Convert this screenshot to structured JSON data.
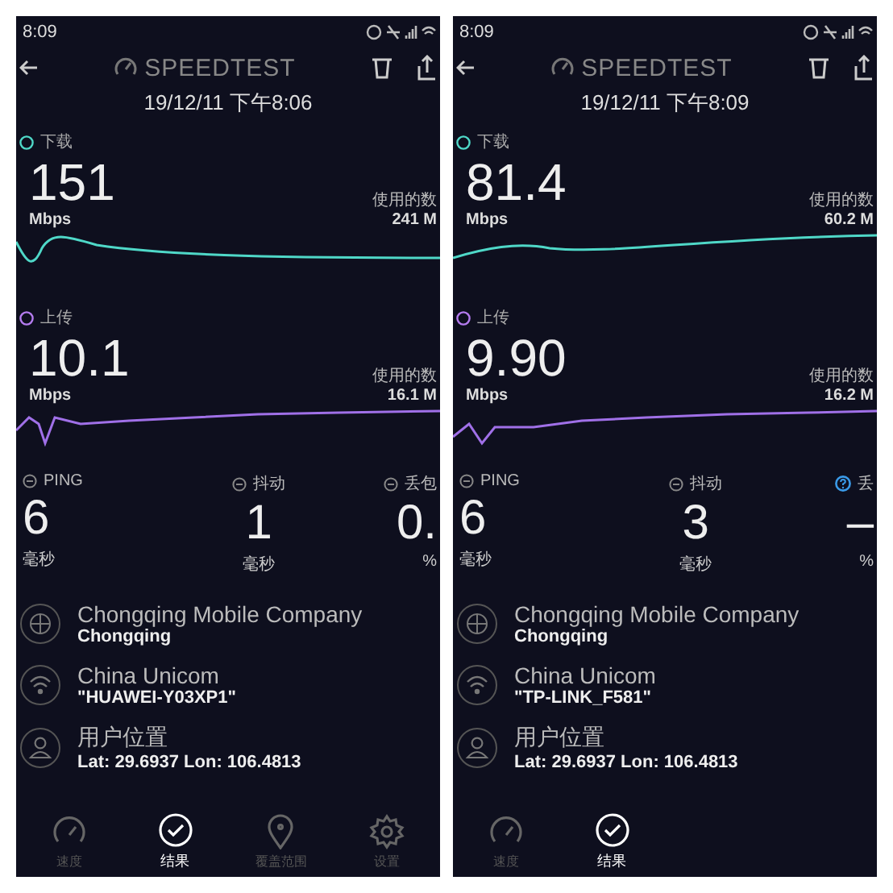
{
  "panels": [
    {
      "status_bar": {
        "time": "8:09"
      },
      "title": "SPEEDTEST",
      "date": "19/12/11 下午8:06",
      "download": {
        "label": "下载",
        "value": "151",
        "unit": "Mbps",
        "data_label": "使用的数",
        "data_value": "241 M"
      },
      "upload": {
        "label": "上传",
        "value": "10.1",
        "unit": "Mbps",
        "data_label": "使用的数",
        "data_value": "16.1 M"
      },
      "metrics": [
        {
          "kind": "minus",
          "label": "PING",
          "value": "6",
          "unit": "毫秒"
        },
        {
          "kind": "minus",
          "label": "抖动",
          "value": "1",
          "unit": "毫秒"
        },
        {
          "kind": "minus",
          "label": "丢包",
          "value": "0.",
          "unit": "%"
        }
      ],
      "details": [
        {
          "kind": "globe",
          "title": "Chongqing Mobile Company",
          "subtitle": "Chongqing"
        },
        {
          "kind": "wifi",
          "title": "China Unicom",
          "subtitle": "\"HUAWEI-Y03XP1\""
        },
        {
          "kind": "person",
          "title": "用户位置",
          "subtitle": "Lat: 29.6937 Lon: 106.4813"
        }
      ],
      "nav": [
        {
          "kind": "speed",
          "label": "速度",
          "selected": false
        },
        {
          "kind": "check",
          "label": "结果",
          "selected": true
        },
        {
          "kind": "pin",
          "label": "覆盖范围",
          "selected": false
        },
        {
          "kind": "gear",
          "label": "设置",
          "selected": false
        }
      ]
    },
    {
      "status_bar": {
        "time": "8:09"
      },
      "title": "SPEEDTEST",
      "date": "19/12/11 下午8:09",
      "download": {
        "label": "下载",
        "value": "81.4",
        "unit": "Mbps",
        "data_label": "使用的数",
        "data_value": "60.2 M"
      },
      "upload": {
        "label": "上传",
        "value": "9.90",
        "unit": "Mbps",
        "data_label": "使用的数",
        "data_value": "16.2 M"
      },
      "metrics": [
        {
          "kind": "minus",
          "label": "PING",
          "value": "6",
          "unit": "毫秒"
        },
        {
          "kind": "minus",
          "label": "抖动",
          "value": "3",
          "unit": "毫秒"
        },
        {
          "kind": "help",
          "label": "丢",
          "value": "–",
          "unit": "%"
        }
      ],
      "details": [
        {
          "kind": "globe",
          "title": "Chongqing Mobile Company",
          "subtitle": "Chongqing"
        },
        {
          "kind": "wifi",
          "title": "China Unicom",
          "subtitle": "\"TP-LINK_F581\""
        },
        {
          "kind": "person",
          "title": "用户位置",
          "subtitle": "Lat: 29.6937 Lon: 106.4813"
        }
      ],
      "nav": [
        {
          "kind": "speed",
          "label": "速度",
          "selected": false
        },
        {
          "kind": "check",
          "label": "结果",
          "selected": true
        }
      ]
    }
  ]
}
